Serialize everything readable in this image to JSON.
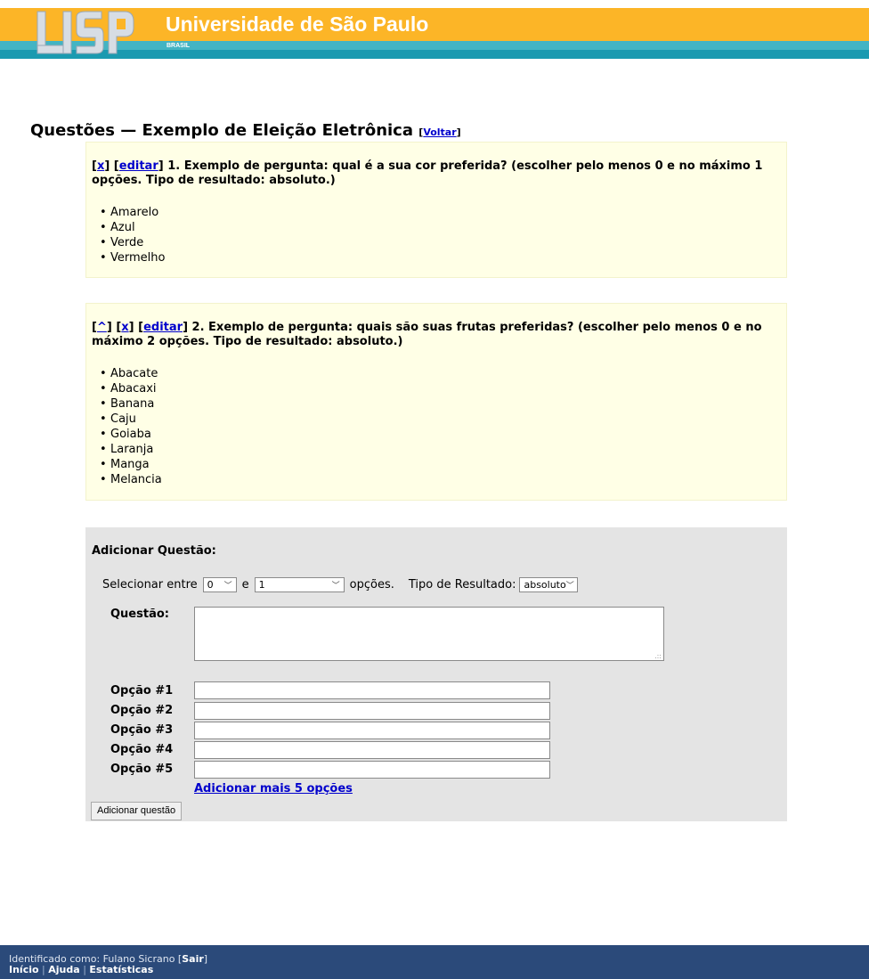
{
  "header": {
    "site_title": "Universidade de São Paulo",
    "site_subtitle": "BRASIL",
    "logo_text": "USP",
    "colors": {
      "orange": "#fcb527",
      "teal": "#43b4c3",
      "blue": "#1b9ab0"
    }
  },
  "page": {
    "title": "Questões — Exemplo de Eleição Eletrônica",
    "back_link": "Voltar"
  },
  "questions": [
    {
      "up_link": "",
      "delete_link": "x",
      "edit_link": "editar",
      "text": "1. Exemplo de pergunta: qual é a sua cor preferida? (escolher pelo menos 0 e no máximo 1 opções. Tipo de resultado: absoluto.)",
      "options": [
        "Amarelo",
        "Azul",
        "Verde",
        "Vermelho"
      ]
    },
    {
      "up_link": "^",
      "delete_link": "x",
      "edit_link": "editar",
      "text": "2. Exemplo de pergunta: quais são suas frutas preferidas? (escolher pelo menos 0 e no máximo 2 opções. Tipo de resultado: absoluto.)",
      "options": [
        "Abacate",
        "Abacaxi",
        "Banana",
        "Caju",
        "Goiaba",
        "Laranja",
        "Manga",
        "Melancia"
      ]
    }
  ],
  "add_form": {
    "title": "Adicionar Questão:",
    "select_between_label": "Selecionar entre",
    "min_value": "0",
    "and_label": "e",
    "max_value": "1",
    "options_label": "opções.",
    "result_type_label": "Tipo de Resultado:",
    "result_type_value": "absoluto",
    "question_label": "Questão:",
    "question_value": "",
    "option_labels": [
      "Opção #1",
      "Opção #2",
      "Opção #3",
      "Opção #4",
      "Opção #5"
    ],
    "add_more_link": "Adicionar mais 5 opções",
    "submit_button": "Adicionar questão"
  },
  "footer": {
    "identified_as": "Identificado como: Fulano Sicrano",
    "logout": "Sair",
    "nav": [
      "Início",
      "Ajuda",
      "Estatísticas"
    ],
    "background": "#2b4a7a"
  }
}
